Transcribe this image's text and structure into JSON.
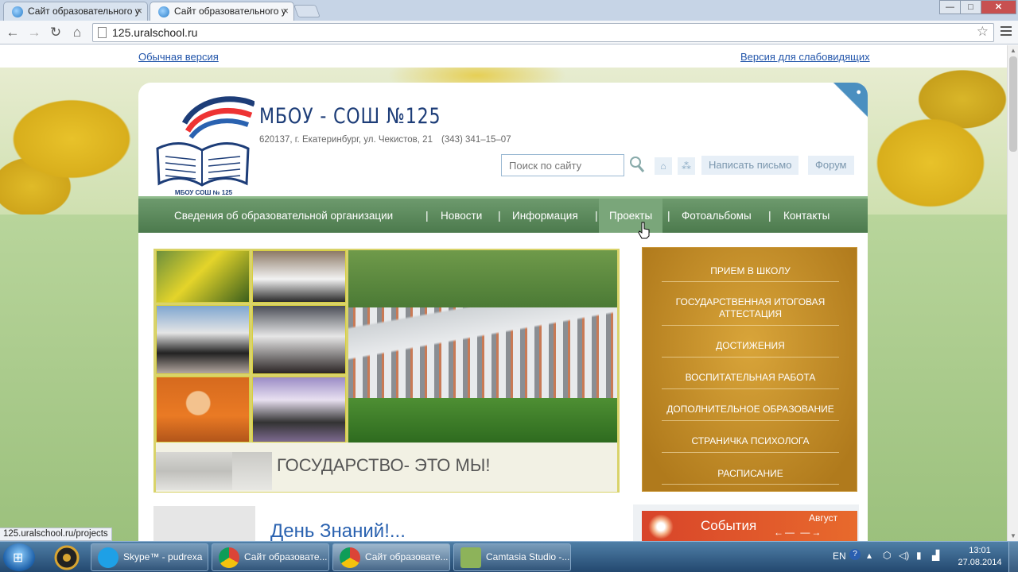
{
  "browser": {
    "tabs": [
      {
        "label": "Сайт образовательного у",
        "active": false
      },
      {
        "label": "Сайт образовательного у",
        "active": true
      }
    ],
    "url": "125.uralschool.ru",
    "window_controls": {
      "minimize": "—",
      "maximize": "□",
      "close": "✕"
    },
    "status_url": "125.uralschool.ru/projects"
  },
  "version_links": {
    "normal": "Обычная версия",
    "impaired": "Версия для слабовидящих"
  },
  "header": {
    "logo_caption": "МБОУ СОШ № 125",
    "title": "МБОУ - СОШ №125",
    "address": "620137, г. Екатеринбург, ул. Чекистов, 21",
    "phone": "(343) 341–15–07",
    "search_placeholder": "Поиск по сайту",
    "write_letter": "Написать письмо",
    "forum": "Форум"
  },
  "nav": {
    "items": [
      {
        "label": "Сведения об образовательной организации",
        "active": false
      },
      {
        "label": "Новости",
        "active": false
      },
      {
        "label": "Информация",
        "active": false
      },
      {
        "label": "Проекты",
        "active": true
      },
      {
        "label": "Фотоальбомы",
        "active": false
      },
      {
        "label": "Контакты",
        "active": false
      }
    ],
    "separator": "|"
  },
  "slider": {
    "caption": "ГОСУДАРСТВО- ЭТО МЫ!"
  },
  "side_menu": {
    "items": [
      {
        "label": "ПРИЕМ В ШКОЛУ"
      },
      {
        "label": "ГОСУДАРСТВЕННАЯ ИТОГОВАЯ АТТЕСТАЦИЯ"
      },
      {
        "label": "ДОСТИЖЕНИЯ"
      },
      {
        "label": "ВОСПИТАТЕЛЬНАЯ РАБОТА"
      },
      {
        "label": "ДОПОЛНИТЕЛЬНОЕ ОБРАЗОВАНИЕ"
      },
      {
        "label": "СТРАНИЧКА ПСИХОЛОГА"
      },
      {
        "label": "РАСПИСАНИЕ"
      }
    ]
  },
  "news": {
    "partial_title": "День Знаний!..."
  },
  "events": {
    "label": "События",
    "month": "Август",
    "arrows": "←—  —→"
  },
  "taskbar": {
    "buttons": [
      {
        "label": "Skype™ - pudrexa",
        "icon": "skype-icon"
      },
      {
        "label": "Сайт образовате...",
        "icon": "chrome-icon"
      },
      {
        "label": "Сайт образовате...",
        "icon": "chrome-icon"
      },
      {
        "label": "Camtasia Studio -...",
        "icon": "camtasia-icon"
      }
    ],
    "language": "EN",
    "time": "13:01",
    "date": "27.08.2014"
  },
  "colors": {
    "nav_green": "#5a8a5b",
    "side_menu_gold": "#c48f2a",
    "title_blue": "#1d3d78",
    "events_red": "#dd4f2b"
  }
}
